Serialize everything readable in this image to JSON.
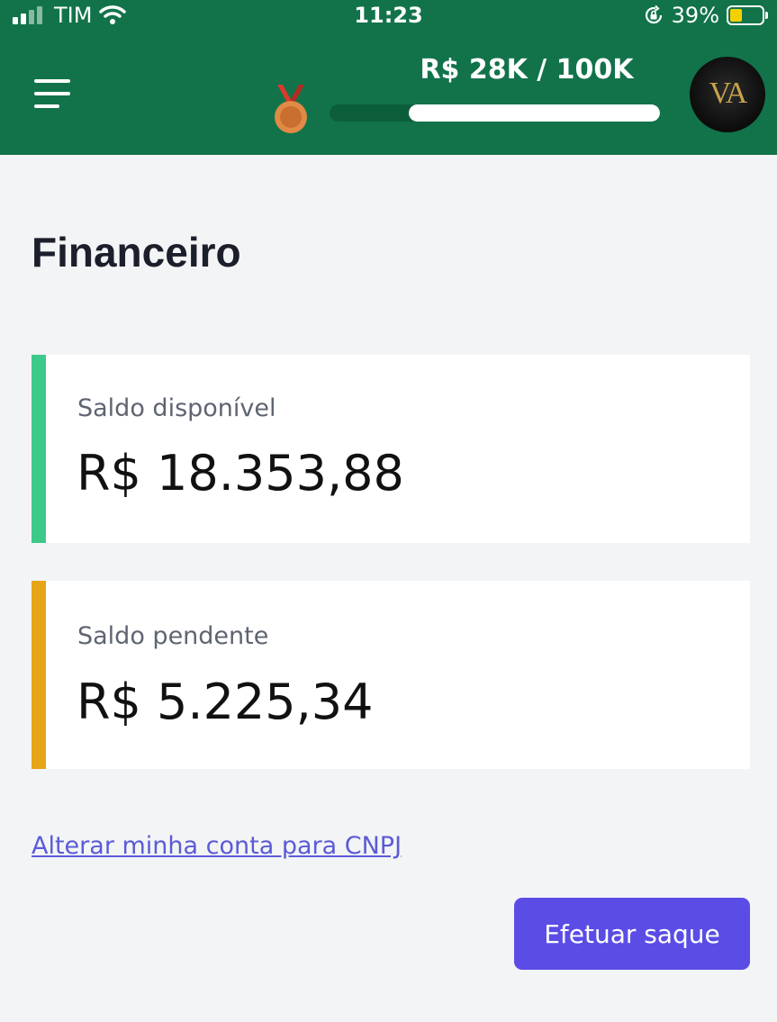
{
  "status_bar": {
    "carrier": "TIM",
    "time": "11:23",
    "battery_percent": "39%",
    "battery_level": 0.39,
    "icons": [
      "signal-icon",
      "wifi-icon",
      "orientation-lock-icon",
      "battery-icon"
    ]
  },
  "header": {
    "goal_text": "R$ 28K / 100K",
    "goal_progress": 0.28,
    "medal_icon": "bronze-medal-icon",
    "avatar_initials": "VA",
    "menu_icon": "hamburger-menu-icon",
    "colors": {
      "background": "#12734a",
      "progress_track": "#0c5e3b",
      "progress_fill": "#ffffff"
    }
  },
  "main": {
    "title": "Financeiro",
    "cards": [
      {
        "label": "Saldo disponível",
        "value": "R$ 18.353,88",
        "accent": "#3cc98a"
      },
      {
        "label": "Saldo pendente",
        "value": "R$ 5.225,34",
        "accent": "#e6a417"
      }
    ],
    "cnpj_link": "Alterar minha conta para CNPJ",
    "withdraw_button": "Efetuar saque",
    "colors": {
      "page_background": "#f3f4f6",
      "button": "#5b4ce6",
      "link": "#5b5bd6"
    }
  }
}
